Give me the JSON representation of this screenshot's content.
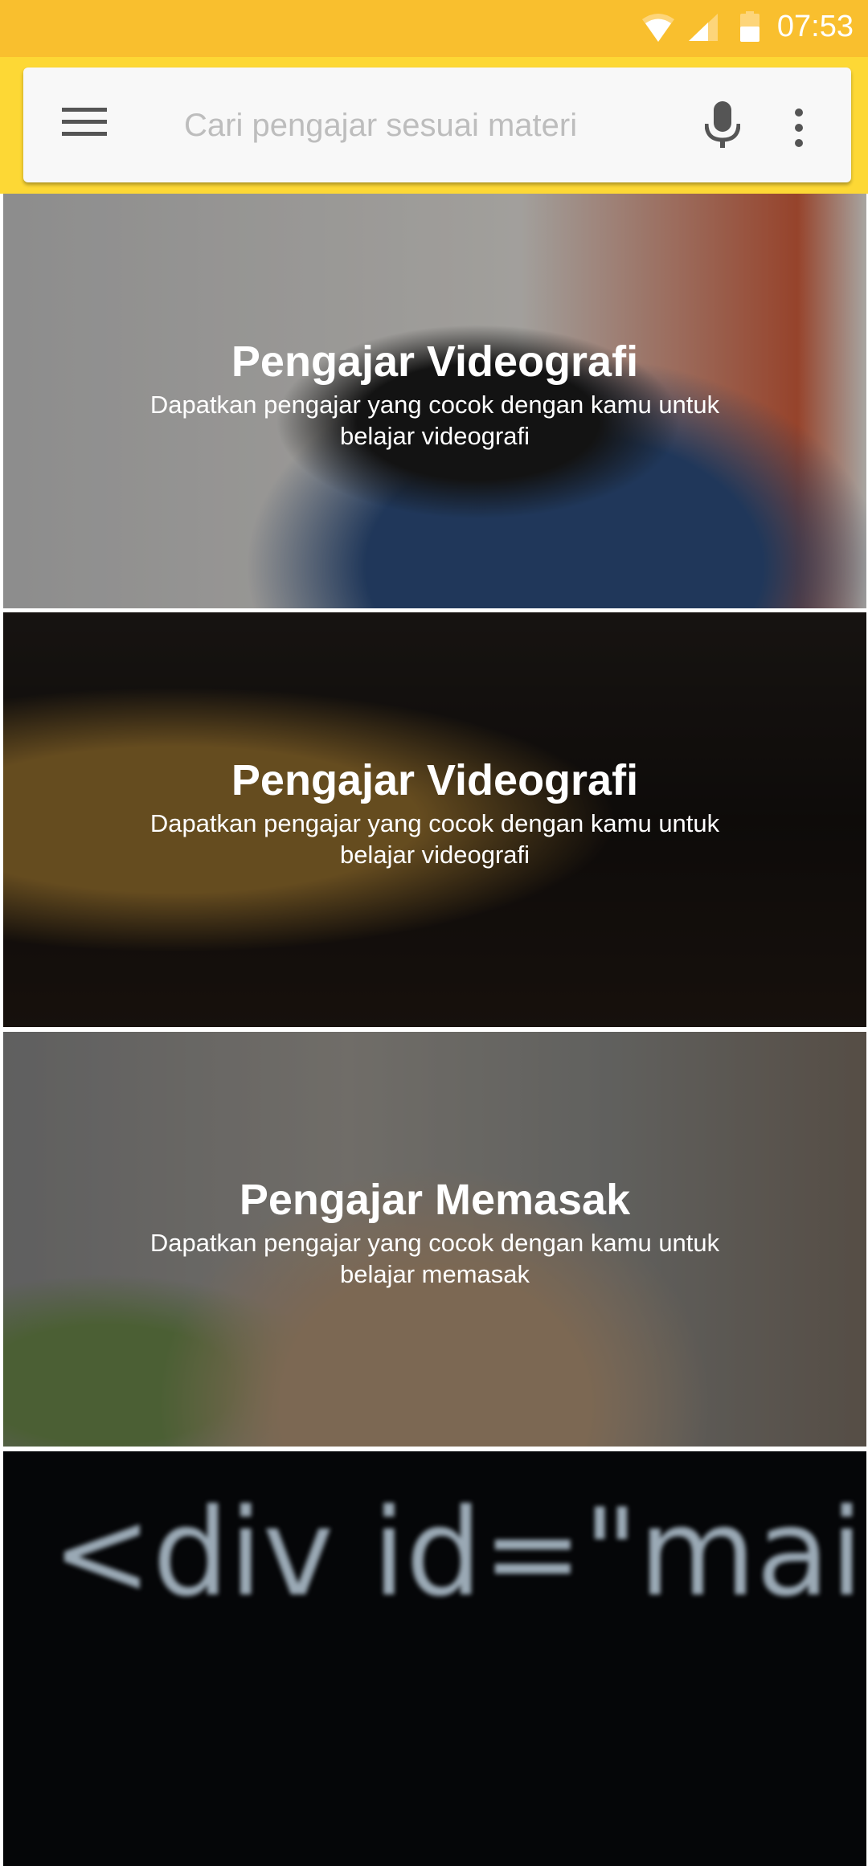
{
  "status_bar": {
    "time": "07:53",
    "icons": [
      "wifi-icon",
      "signal-icon",
      "battery-icon"
    ],
    "color": "#F9BF2E"
  },
  "search": {
    "placeholder": "Cari pengajar sesuai materi",
    "icons": [
      "menu-icon",
      "mic-icon",
      "more-vert-icon"
    ]
  },
  "colors": {
    "header": "#FDD835",
    "search_bg": "#F8F8F8"
  },
  "cards": [
    {
      "title": "Pengajar Videografi",
      "subtitle": "Dapatkan pengajar yang cocok dengan kamu untuk belajar videografi"
    },
    {
      "title": "Pengajar Videografi",
      "subtitle": "Dapatkan pengajar yang cocok dengan kamu untuk belajar videografi"
    },
    {
      "title": "Pengajar Memasak",
      "subtitle": "Dapatkan pengajar yang cocok dengan kamu untuk belajar memasak"
    },
    {
      "image_text": "<div id=\"main content\">"
    }
  ]
}
